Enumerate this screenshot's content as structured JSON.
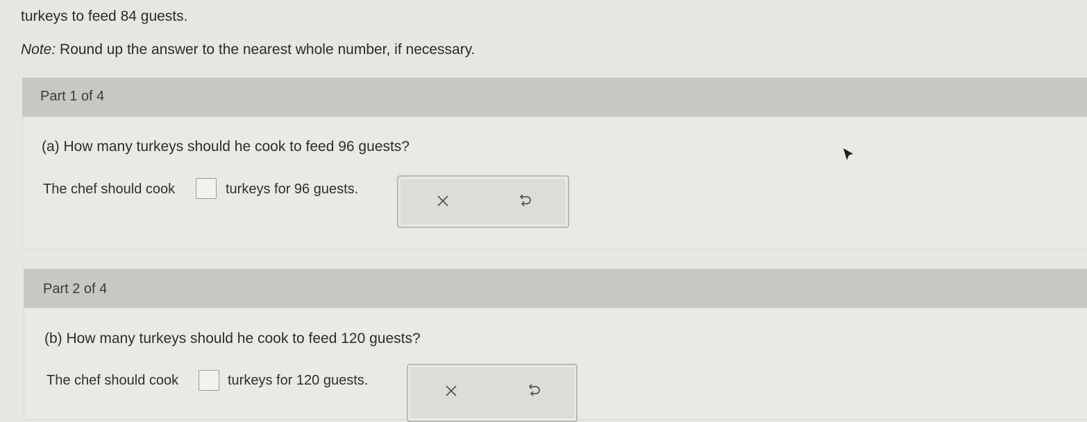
{
  "intro": {
    "line1": "turkeys to feed 84 guests.",
    "note_label": "Note:",
    "note_text": " Round up the answer to the nearest whole number, if necessary."
  },
  "parts": [
    {
      "label": "Part 1 of 4",
      "question": "(a) How many turkeys should he cook to feed 96 guests?",
      "answer_prefix": "The chef should cook",
      "answer_suffix": "turkeys for 96 guests.",
      "answer_value": ""
    },
    {
      "label": "Part 2 of 4",
      "question": "(b) How many turkeys should he cook to feed 120 guests?",
      "answer_prefix": "The chef should cook",
      "answer_suffix": "turkeys for 120 guests.",
      "answer_value": ""
    }
  ],
  "icons": {
    "clear": "close-icon",
    "reset": "undo-icon"
  },
  "colors": {
    "part_bar": "#c7c8c4",
    "panel": "#dcdcd8",
    "icon_stroke": "#555555"
  }
}
